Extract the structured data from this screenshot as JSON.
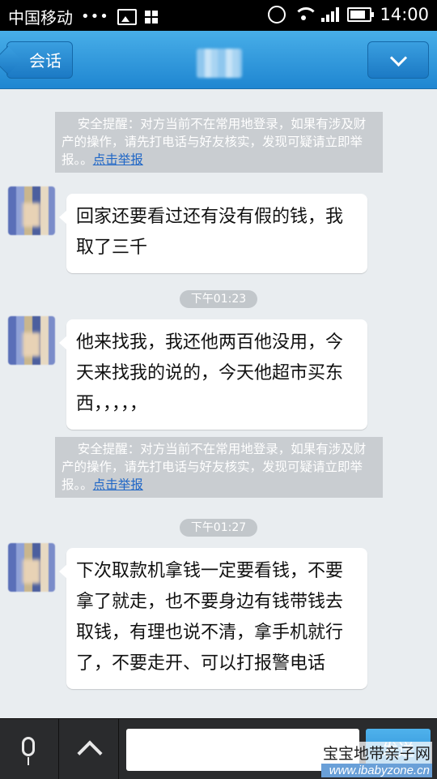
{
  "status_bar": {
    "carrier": "中国移动",
    "dots": "•••",
    "time": "14:00"
  },
  "header": {
    "back_label": "会话"
  },
  "notice": {
    "text": "安全提醒：对方当前不在常用地登录，如果有涉及财产的操作，请先打电话与好友核实，发现可疑请立即举报。。",
    "link": "点击举报"
  },
  "messages": [
    {
      "text": "回家还要看过还有没有假的钱，我取了三千"
    },
    {
      "time": "下午01:23",
      "text": "他来找我，我还他两百他没用，今天来找我的说的，今天他超市买东西，，，，，"
    },
    {
      "time": "下午01:27",
      "text": "下次取款机拿钱一定要看钱，不要拿了就走，也不要身边有钱带钱去取钱，有理也说不清，拿手机就行了，不要走开、可以打报警电话"
    }
  ],
  "bottom": {
    "send_label": "发送",
    "input_value": ""
  },
  "watermark": {
    "line1": "宝宝地带亲子网",
    "line2": "www.ibabyzone.cn"
  },
  "colors": {
    "header": "#2b93d8",
    "notice_bg": "#c9cdd1",
    "link": "#1f66c6",
    "background": "#e9edf0"
  }
}
